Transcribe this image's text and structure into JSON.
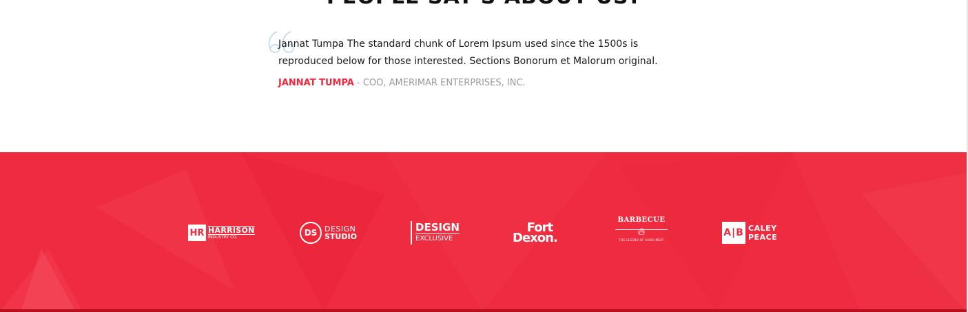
{
  "section": {
    "heading": "PEOPLE SAY'S ABOUT US?"
  },
  "testimonial": {
    "quote": "Jannat Tumpa The standard chunk of Lorem Ipsum used since the 1500s is reproduced below for those interested. Sections Bonorum et Malorum original.",
    "author_name": "JANNAT TUMPA",
    "separator": " - ",
    "author_role": "COO, AMERIMAR ENTERPRISES, INC.",
    "quote_icon": "quote-icon"
  },
  "colors": {
    "accent": "#ef2b3f",
    "text": "#1a1a1a",
    "muted": "#999999"
  },
  "clients": {
    "harrison": {
      "mark": "HR",
      "name": "HARRISON",
      "sub": "INDUSTRY CO."
    },
    "design_studio": {
      "mark": "DS",
      "line1": "DESIGN",
      "line2": "STUDIO"
    },
    "design_exclusive": {
      "line1": "DESIGN",
      "line2": "EXCLUSIVE"
    },
    "fort_dexon": {
      "line1": "Fort",
      "line2": "Dexon."
    },
    "barbecue": {
      "title": "BARBECUE",
      "tagline": "THE LEGEND OF GOOD MEAT",
      "icon": "flame-icon"
    },
    "caley_peace": {
      "mark": "A|B",
      "line1": "CALEY",
      "line2": "PEACE"
    }
  }
}
